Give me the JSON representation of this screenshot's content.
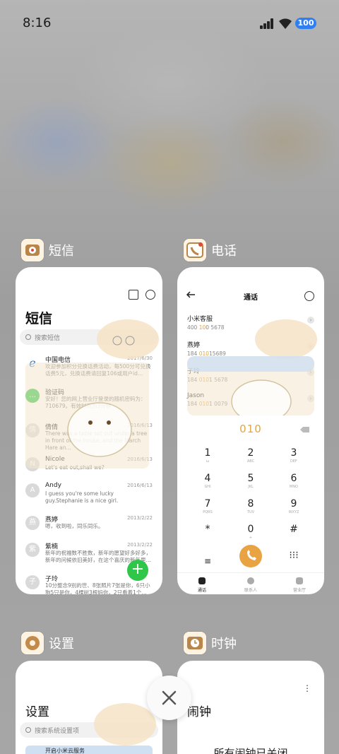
{
  "status": {
    "time": "8:16",
    "battery": "100"
  },
  "colors": {
    "accent_orange": "#e0a645",
    "green": "#2fc64a",
    "battery_blue": "#2f7ff0"
  },
  "apps": {
    "sms": {
      "name": "短信",
      "icon": "sms-app-icon",
      "title": "短信",
      "search_placeholder": "搜索短信",
      "messages": [
        {
          "name": "中国电信",
          "date": "2017/6/30",
          "body": "欢迎参加积分兑换话费活动，每500分可兑换话费5元，兑换话费请回复106或用户id…",
          "avatar": ""
        },
        {
          "name": "验证码",
          "date": "",
          "body": "安好！您的网上营业厅登录的随机密码为：710679。有效时间为3分钟",
          "avatar": ""
        },
        {
          "name": "倩倩",
          "date": "2016/6/13",
          "body": "There was a table set out under a tree in front of the house, and the March Hare an…",
          "avatar": "倩"
        },
        {
          "name": "Nicole",
          "date": "2016/6/13",
          "body": "Let's eat out,shall we?",
          "avatar": "N"
        },
        {
          "name": "Andy",
          "date": "2016/6/13",
          "body": "I guess you're some lucky guy.Stephanie is a nice girl.",
          "avatar": "A"
        },
        {
          "name": "燕婷",
          "date": "2013/2/22",
          "body": "嗯，收到啦，同乐同乐。",
          "avatar": "燕"
        },
        {
          "name": "紫楠",
          "date": "2013/2/22",
          "body": "新年的祝福数不胜数，新年的愿望好多好多，新年的问候依旧美好，在这个喜庆的新年里…",
          "avatar": "紫"
        },
        {
          "name": "子玲",
          "date": "",
          "body": "10分整念9别的世、8张照片7张是你，6只小狗5只是你，4棵树3根妈你，2只看着1个…",
          "avatar": "子"
        }
      ],
      "fab": "+"
    },
    "phone": {
      "name": "电话",
      "icon": "phone-app-icon",
      "title": "通话",
      "contacts": [
        {
          "name": "小米客服",
          "num_pre": "400 ",
          "num_hl": "10",
          "num_post": "0 5678"
        },
        {
          "name": "燕婷",
          "num_pre": "184 ",
          "num_hl": "010",
          "num_post": "15689"
        },
        {
          "name": "子玲",
          "num_pre": "184 ",
          "num_hl": "010",
          "num_post": "1 5678"
        },
        {
          "name": "Jason",
          "num_pre": "184 ",
          "num_hl": "010",
          "num_post": "1 0079"
        }
      ],
      "dial_value": "010",
      "keys": [
        {
          "d": "1",
          "l": "ω"
        },
        {
          "d": "2",
          "l": "ABC"
        },
        {
          "d": "3",
          "l": "DEF"
        },
        {
          "d": "4",
          "l": "GHI"
        },
        {
          "d": "5",
          "l": "JKL"
        },
        {
          "d": "6",
          "l": "MNO"
        },
        {
          "d": "7",
          "l": "PQRS"
        },
        {
          "d": "8",
          "l": "TUV"
        },
        {
          "d": "9",
          "l": "WXYZ"
        },
        {
          "d": "*",
          "l": ""
        },
        {
          "d": "0",
          "l": "+"
        },
        {
          "d": "#",
          "l": ""
        }
      ],
      "tabs": [
        "通话",
        "联系人",
        "营业厅"
      ]
    },
    "settings": {
      "name": "设置",
      "icon": "settings-app-icon",
      "title": "设置",
      "search_placeholder": "搜索系统设置项",
      "first_item": "开启小米云服务"
    },
    "clock": {
      "name": "时钟",
      "icon": "clock-app-icon",
      "title": "闹钟",
      "empty_text": "所有闹钟已关闭"
    }
  }
}
